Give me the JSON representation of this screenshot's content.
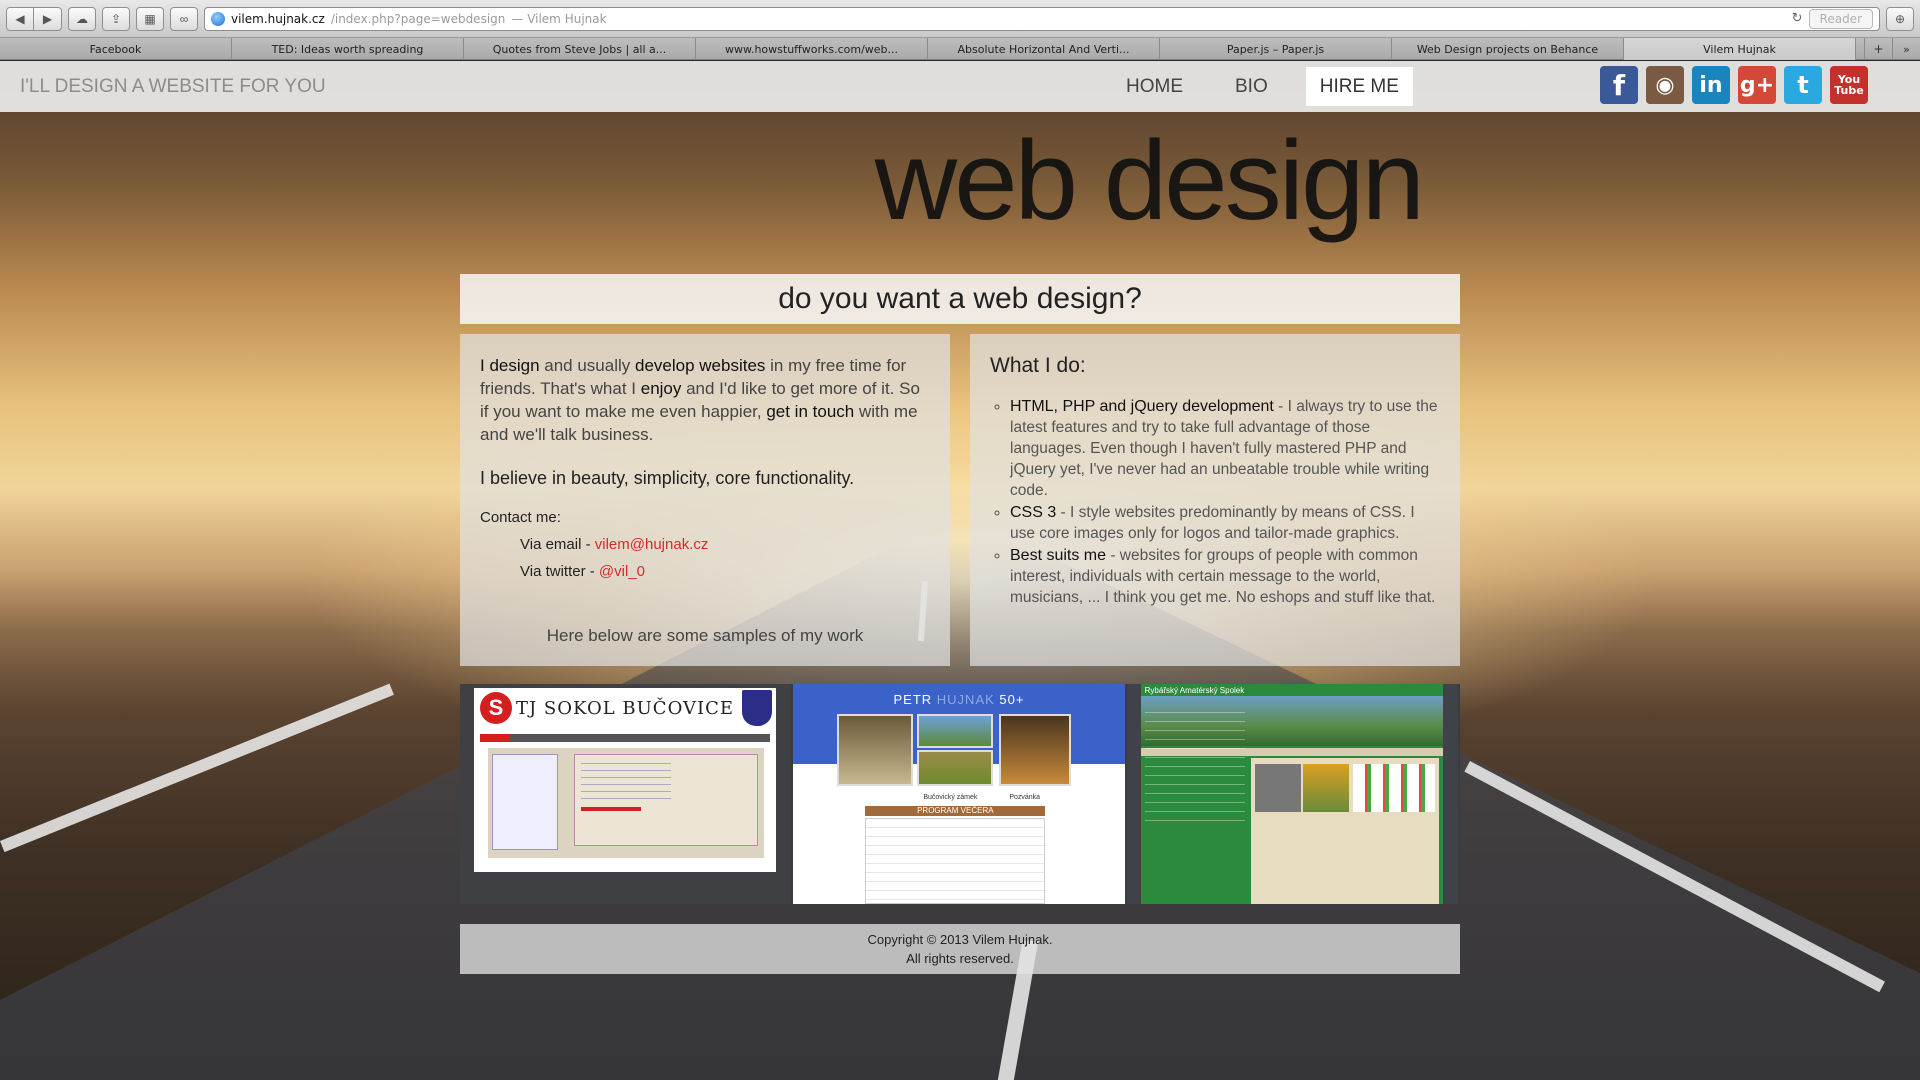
{
  "browser": {
    "url_domain": "vilem.hujnak.cz",
    "url_rest": "/index.php?page=webdesign",
    "page_title": "— Vilem Hujnak",
    "reader_label": "Reader",
    "tabs": [
      {
        "label": "Facebook"
      },
      {
        "label": "TED: Ideas worth spreading"
      },
      {
        "label": "Quotes from Steve Jobs | all a..."
      },
      {
        "label": "www.howstuffworks.com/web..."
      },
      {
        "label": "Absolute Horizontal And Verti..."
      },
      {
        "label": "Paper.js – Paper.js"
      },
      {
        "label": "Web Design projects on Behance"
      },
      {
        "label": "Vilem Hujnak"
      }
    ]
  },
  "nav": {
    "brand": "I'LL DESIGN A WEBSITE FOR YOU",
    "links": [
      {
        "label": "HOME"
      },
      {
        "label": "BIO"
      },
      {
        "label": "HIRE ME"
      }
    ],
    "social": [
      {
        "icon": "facebook-icon",
        "glyph": "f"
      },
      {
        "icon": "instagram-icon",
        "glyph": "◉"
      },
      {
        "icon": "linkedin-icon",
        "glyph": "in"
      },
      {
        "icon": "google-plus-icon",
        "glyph": "g+"
      },
      {
        "icon": "twitter-icon",
        "glyph": "t"
      },
      {
        "icon": "youtube-icon",
        "glyph_top": "You",
        "glyph_bottom": "Tube"
      }
    ]
  },
  "hero": {
    "title": "web design",
    "question": "do you want a web design?"
  },
  "intro": {
    "p1_a": "I design",
    "p1_b": " and usually ",
    "p1_c": "develop websites",
    "p1_d": " in my free time for friends. That's what I ",
    "p1_e": "enjoy",
    "p1_f": " and I'd like to get more of it. So if you want to make me even happier, ",
    "p1_g": "get in touch",
    "p1_h": " with me and we'll talk business.",
    "belief": "I believe in beauty, simplicity, core functionality.",
    "contact_heading": "Contact me:",
    "email_prefix": "Via email - ",
    "email": "vilem@hujnak.cz",
    "twitter_prefix": "Via twitter - ",
    "twitter": "@vil_0",
    "samples_note": "Here below are some samples of my work"
  },
  "what_i_do": {
    "title": "What I do:",
    "items": [
      {
        "head": "HTML, PHP and jQuery development",
        "text": " - I always try to use the latest features and try to take full advantage of those languages. Even though I haven't fully mastered PHP and jQuery yet, I've never had an unbeatable trouble while writing code."
      },
      {
        "head": "CSS 3",
        "text": " - I style websites predominantly by means of CSS. I use core images only for logos and tailor-made graphics."
      },
      {
        "head": "Best suits me",
        "text": " - websites for groups of people with common interest, individuals with certain message to the world, musicians, ... I think you get me. No eshops and stuff like that."
      }
    ]
  },
  "samples": [
    {
      "title": "TJ SOKOL BUČOVICE"
    },
    {
      "title_a": "PETR",
      "title_b": "HUJNAK",
      "title_c": "50+",
      "caption_1": "Bučovický zámek",
      "caption_2": "Pozvánka",
      "program": "PROGRAM VEČERA"
    },
    {
      "title": "Rybářský Amatérský Spolek"
    }
  ],
  "footer": {
    "line1": "Copyright © 2013 Vilem Hujnak.",
    "line2": "All rights reserved."
  }
}
